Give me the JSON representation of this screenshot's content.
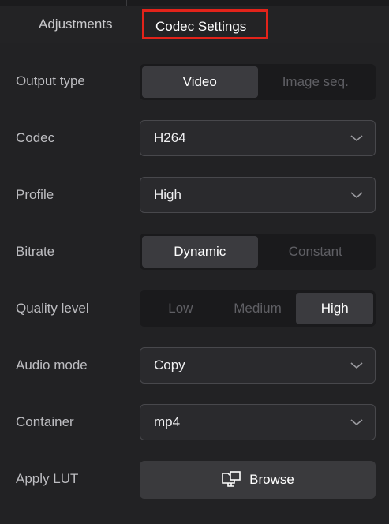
{
  "tabs": {
    "adjustments": "Adjustments",
    "codec_settings": "Codec Settings"
  },
  "highlight_color": "#e2231a",
  "rows": {
    "output_type": {
      "label": "Output type",
      "options": [
        "Video",
        "Image seq."
      ],
      "selected": "Video"
    },
    "codec": {
      "label": "Codec",
      "value": "H264"
    },
    "profile": {
      "label": "Profile",
      "value": "High"
    },
    "bitrate": {
      "label": "Bitrate",
      "options": [
        "Dynamic",
        "Constant"
      ],
      "selected": "Dynamic"
    },
    "quality": {
      "label": "Quality level",
      "options": [
        "Low",
        "Medium",
        "High"
      ],
      "selected": "High"
    },
    "audio": {
      "label": "Audio mode",
      "value": "Copy"
    },
    "container": {
      "label": "Container",
      "value": "mp4"
    },
    "lut": {
      "label": "Apply LUT",
      "button": "Browse",
      "icon": "folder-browse-icon"
    }
  }
}
